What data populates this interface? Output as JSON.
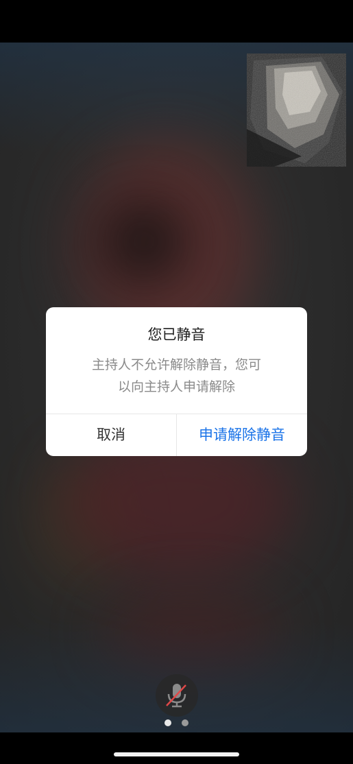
{
  "dialog": {
    "title": "您已静音",
    "message_line1": "主持人不允许解除静音，您可",
    "message_line2": "以向主持人申请解除",
    "cancel_label": "取消",
    "request_label": "申请解除静音"
  },
  "controls": {
    "mic_icon": "mic-muted-icon",
    "page_count": 2,
    "current_page": 1
  },
  "colors": {
    "accent": "#1a73e8",
    "muted_slash": "#e04848"
  }
}
